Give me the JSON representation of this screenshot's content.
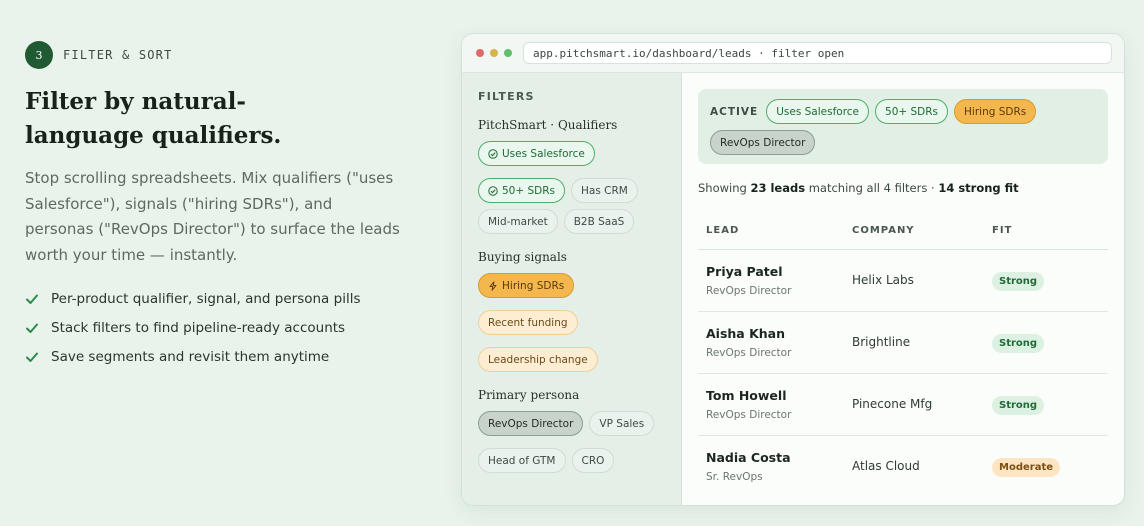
{
  "section": {
    "step_number": "3",
    "step_label": "FILTER & SORT",
    "headline": "Filter by natural-language qualifiers.",
    "description": "Stop scrolling spreadsheets. Mix qualifiers (\"uses Salesforce\"), signals (\"hiring SDRs\"), and personas (\"RevOps Director\") to surface the leads worth your time — instantly.",
    "features": [
      "Per-product qualifier, signal, and persona pills",
      "Stack filters to find pipeline-ready accounts",
      "Save segments and revisit them anytime"
    ]
  },
  "browser": {
    "url": "app.pitchsmart.io/dashboard/leads · filter open",
    "dot_colors": [
      "#e06a6a",
      "#d9b24a",
      "#5fbf6e"
    ]
  },
  "sidebar": {
    "title": "FILTERS",
    "groups": [
      {
        "title": "PitchSmart · Qualifiers",
        "pills": [
          {
            "label": "Uses Salesforce",
            "state": "q-on",
            "icon": "check-circle-icon"
          },
          {
            "label": "50+ SDRs",
            "state": "q-on",
            "icon": "check-circle-icon"
          },
          {
            "label": "Has CRM",
            "state": "off"
          },
          {
            "label": "Mid-market",
            "state": "off"
          },
          {
            "label": "B2B SaaS",
            "state": "off"
          }
        ]
      },
      {
        "title": "Buying signals",
        "pills": [
          {
            "label": "Hiring SDRs",
            "state": "s-on",
            "icon": "lightning-icon"
          },
          {
            "label": "Recent funding",
            "state": "s-off"
          },
          {
            "label": "Leadership change",
            "state": "s-off"
          }
        ]
      },
      {
        "title": "Primary persona",
        "pills": [
          {
            "label": "RevOps Director",
            "state": "p-on"
          },
          {
            "label": "VP Sales",
            "state": "off"
          },
          {
            "label": "Head of GTM",
            "state": "off"
          },
          {
            "label": "CRO",
            "state": "off"
          }
        ]
      }
    ]
  },
  "main": {
    "active_label": "ACTIVE",
    "active_filters": [
      {
        "label": "Uses Salesforce",
        "state": "q-on"
      },
      {
        "label": "50+ SDRs",
        "state": "q-on"
      },
      {
        "label": "Hiring SDRs",
        "state": "s-on"
      },
      {
        "label": "RevOps Director",
        "state": "p-on"
      }
    ],
    "summary": {
      "prefix": "Showing ",
      "count": "23 leads",
      "middle": " matching all 4 filters · ",
      "strong": "14 strong fit"
    },
    "columns": [
      "LEAD",
      "COMPANY",
      "FIT"
    ],
    "rows": [
      {
        "name": "Priya Patel",
        "role": "RevOps Director",
        "company": "Helix Labs",
        "fit": "Strong",
        "fit_type": "strong"
      },
      {
        "name": "Aisha Khan",
        "role": "RevOps Director",
        "company": "Brightline",
        "fit": "Strong",
        "fit_type": "strong"
      },
      {
        "name": "Tom Howell",
        "role": "RevOps Director",
        "company": "Pinecone Mfg",
        "fit": "Strong",
        "fit_type": "strong"
      },
      {
        "name": "Nadia Costa",
        "role": "Sr. RevOps",
        "company": "Atlas Cloud",
        "fit": "Moderate",
        "fit_type": "moderate"
      }
    ]
  }
}
